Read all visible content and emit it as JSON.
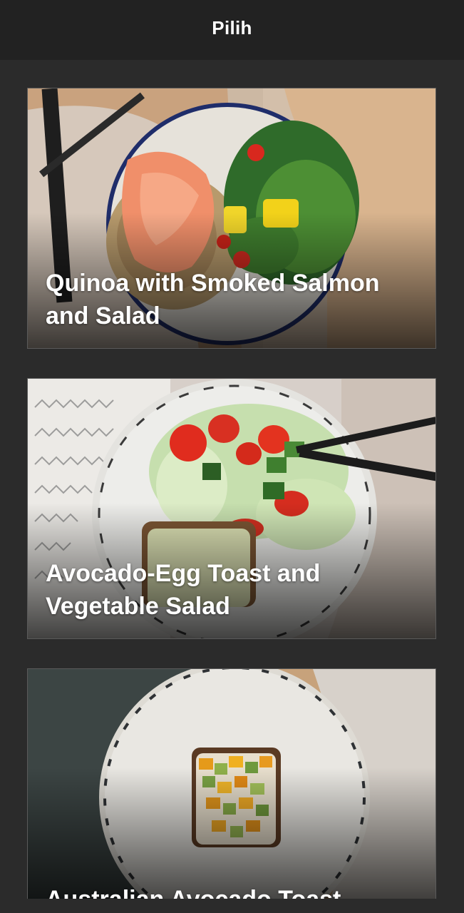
{
  "header": {
    "title": "Pilih"
  },
  "recipes": [
    {
      "title": "Quinoa with Smoked Salmon and Salad",
      "image": "salmon-quinoa-plate-photo"
    },
    {
      "title": "Avocado-Egg Toast and Vegetable Salad",
      "image": "avocado-egg-toast-salad-photo"
    },
    {
      "title": "Australian Avocado Toast",
      "image": "avocado-toast-plate-photo"
    }
  ]
}
